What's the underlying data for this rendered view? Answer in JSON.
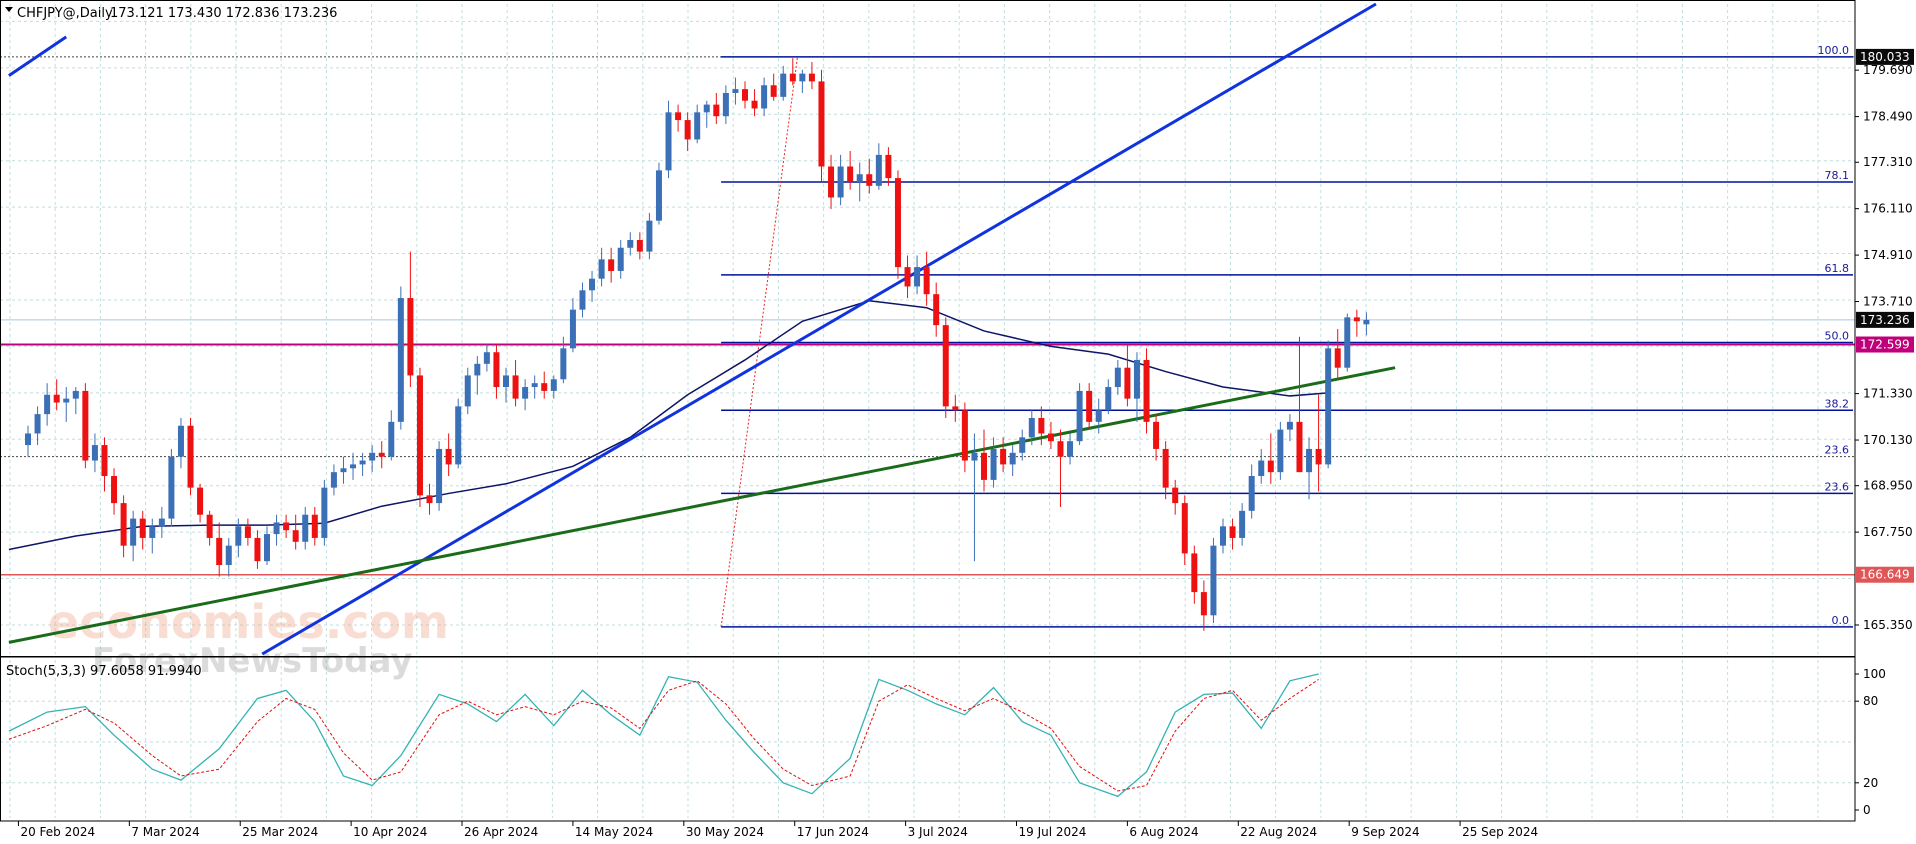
{
  "header": {
    "symbol_label": "CHFJPY@,Daily",
    "ohlc": "173.121 173.430 172.836 173.236",
    "stoch_label": "Stoch(5,3,3) 97.6058 91.9940"
  },
  "watermark": {
    "line1": "economies.com",
    "line2": "ForexNewsToday"
  },
  "colors": {
    "bull": "#3b6fb6",
    "bear": "#ee1111",
    "ma": "#0d1566",
    "trend_blue": "#1133dd",
    "trend_green": "#1a6b1a",
    "fib": "#00129b",
    "magenta": "#c0007a",
    "red_level": "#e05555",
    "stoch_main": "#33b3b3",
    "stoch_signal": "#e01010",
    "grid": "#c4dede"
  },
  "chart_data": {
    "type": "candlestick",
    "ylim": [
      164.6,
      181.4
    ],
    "x_tick_labels": [
      "20 Feb 2024",
      "7 Mar 2024",
      "25 Mar 2024",
      "10 Apr 2024",
      "26 Apr 2024",
      "14 May 2024",
      "30 May 2024",
      "17 Jun 2024",
      "3 Jul 2024",
      "19 Jul 2024",
      "6 Aug 2024",
      "22 Aug 2024",
      "9 Sep 2024",
      "25 Sep 2024"
    ],
    "y_tick_labels": [
      179.69,
      178.49,
      177.31,
      176.11,
      174.91,
      173.71,
      171.33,
      170.13,
      168.95,
      167.75,
      165.35
    ],
    "price_tags": [
      {
        "value": 180.033,
        "label": "180.033",
        "style": "dark"
      },
      {
        "value": 173.236,
        "label": "173.236",
        "style": "dark"
      },
      {
        "value": 172.599,
        "label": "172.599",
        "style": "magenta"
      },
      {
        "value": 166.649,
        "label": "166.649",
        "style": "red"
      }
    ],
    "horizontal_lines": [
      {
        "name": "magenta-resistance",
        "value": 172.599,
        "color": "magenta"
      },
      {
        "name": "red-support",
        "value": 166.649,
        "color": "red"
      },
      {
        "name": "current-price",
        "value": 173.236,
        "color": "light"
      },
      {
        "name": "dotted-top",
        "value": 180.033,
        "color": "dotted"
      },
      {
        "name": "dotted-236",
        "value": 169.7,
        "color": "dotted"
      }
    ],
    "fibonacci": {
      "levels": [
        {
          "label": "100.0",
          "value": 180.033
        },
        {
          "label": "78.1",
          "value": 176.8
        },
        {
          "label": "61.8",
          "value": 174.4
        },
        {
          "label": "50.0",
          "value": 172.65
        },
        {
          "label": "38.2",
          "value": 170.9
        },
        {
          "label": "23.6",
          "value": 168.75
        },
        {
          "label": "0.0",
          "value": 165.3
        }
      ],
      "extra_level": {
        "label": "23.6",
        "value": 169.7
      }
    },
    "trendlines": [
      {
        "name": "blue-trendline-upper",
        "color": "trend_blue",
        "x1": -2,
        "y1": 179.55,
        "x2": 4,
        "y2": 180.55
      },
      {
        "name": "blue-trendline-main",
        "color": "trend_blue",
        "x1": 24.5,
        "y1": 164.6,
        "x2": 141,
        "y2": 181.4
      },
      {
        "name": "green-trendline",
        "color": "trend_green",
        "x1": -2,
        "y1": 164.9,
        "x2": 143,
        "y2": 172.0
      }
    ],
    "fib_swing_line": {
      "x1": 72.5,
      "y1": 165.3,
      "x2": 80.5,
      "y2": 180.05
    },
    "candles": [
      [
        170.0,
        170.5,
        169.7,
        170.3
      ],
      [
        170.3,
        171.0,
        170.0,
        170.8
      ],
      [
        170.8,
        171.6,
        170.5,
        171.3
      ],
      [
        171.3,
        171.7,
        170.9,
        171.1
      ],
      [
        171.1,
        171.5,
        170.6,
        171.2
      ],
      [
        171.2,
        171.5,
        170.8,
        171.4
      ],
      [
        171.4,
        171.6,
        169.4,
        169.6
      ],
      [
        169.6,
        170.3,
        169.3,
        170.0
      ],
      [
        170.0,
        170.2,
        168.8,
        169.2
      ],
      [
        169.2,
        169.4,
        168.2,
        168.5
      ],
      [
        168.5,
        168.7,
        167.1,
        167.4
      ],
      [
        167.4,
        168.3,
        167.0,
        168.1
      ],
      [
        168.1,
        168.3,
        167.3,
        167.6
      ],
      [
        167.6,
        168.1,
        167.2,
        167.9
      ],
      [
        167.9,
        168.4,
        167.6,
        168.1
      ],
      [
        168.1,
        169.9,
        167.9,
        169.7
      ],
      [
        169.7,
        170.7,
        169.4,
        170.5
      ],
      [
        170.5,
        170.7,
        168.7,
        168.9
      ],
      [
        168.9,
        169.0,
        168.0,
        168.2
      ],
      [
        168.2,
        168.3,
        167.4,
        167.6
      ],
      [
        167.6,
        168.0,
        166.6,
        166.9
      ],
      [
        166.9,
        167.6,
        166.6,
        167.4
      ],
      [
        167.4,
        168.1,
        167.1,
        167.9
      ],
      [
        167.9,
        168.1,
        167.4,
        167.6
      ],
      [
        167.6,
        167.8,
        166.8,
        167.0
      ],
      [
        167.0,
        167.9,
        166.9,
        167.7
      ],
      [
        167.7,
        168.2,
        167.4,
        168.0
      ],
      [
        168.0,
        168.2,
        167.6,
        167.8
      ],
      [
        167.8,
        168.2,
        167.3,
        167.5
      ],
      [
        167.5,
        168.4,
        167.3,
        168.2
      ],
      [
        168.2,
        168.4,
        167.4,
        167.6
      ],
      [
        167.6,
        169.1,
        167.4,
        168.9
      ],
      [
        168.9,
        169.5,
        168.7,
        169.3
      ],
      [
        169.3,
        169.7,
        169.0,
        169.4
      ],
      [
        169.4,
        169.8,
        169.1,
        169.5
      ],
      [
        169.5,
        169.8,
        169.2,
        169.6
      ],
      [
        169.6,
        170.0,
        169.3,
        169.8
      ],
      [
        169.8,
        170.1,
        169.4,
        169.7
      ],
      [
        169.7,
        170.9,
        169.6,
        170.6
      ],
      [
        170.6,
        174.1,
        170.4,
        173.8
      ],
      [
        173.8,
        175.0,
        171.5,
        171.8
      ],
      [
        171.8,
        172.0,
        168.4,
        168.7
      ],
      [
        168.7,
        169.0,
        168.2,
        168.5
      ],
      [
        168.5,
        170.1,
        168.3,
        169.9
      ],
      [
        169.9,
        170.3,
        169.2,
        169.5
      ],
      [
        169.5,
        171.2,
        169.4,
        171.0
      ],
      [
        171.0,
        172.0,
        170.8,
        171.8
      ],
      [
        171.8,
        172.3,
        171.3,
        172.1
      ],
      [
        172.1,
        172.6,
        171.9,
        172.4
      ],
      [
        172.4,
        172.6,
        171.2,
        171.5
      ],
      [
        171.5,
        172.0,
        171.1,
        171.8
      ],
      [
        171.8,
        172.2,
        171.0,
        171.2
      ],
      [
        171.2,
        171.7,
        170.9,
        171.5
      ],
      [
        171.5,
        171.8,
        171.2,
        171.6
      ],
      [
        171.6,
        171.9,
        171.2,
        171.4
      ],
      [
        171.4,
        171.8,
        171.2,
        171.7
      ],
      [
        171.7,
        172.8,
        171.6,
        172.5
      ],
      [
        172.5,
        173.8,
        172.4,
        173.5
      ],
      [
        173.5,
        174.2,
        173.3,
        174.0
      ],
      [
        174.0,
        174.5,
        173.7,
        174.3
      ],
      [
        174.3,
        175.1,
        174.1,
        174.8
      ],
      [
        174.8,
        175.1,
        174.2,
        174.5
      ],
      [
        174.5,
        175.3,
        174.3,
        175.1
      ],
      [
        175.1,
        175.5,
        174.9,
        175.3
      ],
      [
        175.3,
        175.5,
        174.8,
        175.0
      ],
      [
        175.0,
        176.0,
        174.8,
        175.8
      ],
      [
        175.8,
        177.3,
        175.7,
        177.1
      ],
      [
        177.1,
        178.9,
        176.9,
        178.6
      ],
      [
        178.6,
        178.8,
        178.1,
        178.4
      ],
      [
        178.4,
        178.6,
        177.6,
        177.9
      ],
      [
        177.9,
        178.8,
        177.8,
        178.6
      ],
      [
        178.6,
        178.9,
        178.2,
        178.8
      ],
      [
        178.8,
        179.1,
        178.3,
        178.5
      ],
      [
        178.5,
        179.3,
        178.3,
        179.1
      ],
      [
        179.1,
        179.5,
        178.8,
        179.2
      ],
      [
        179.2,
        179.4,
        178.7,
        178.9
      ],
      [
        178.9,
        179.2,
        178.5,
        178.7
      ],
      [
        178.7,
        179.5,
        178.5,
        179.3
      ],
      [
        179.3,
        179.6,
        178.9,
        179.0
      ],
      [
        179.0,
        179.8,
        178.9,
        179.6
      ],
      [
        179.6,
        180.0,
        179.3,
        179.4
      ],
      [
        179.4,
        179.7,
        179.1,
        179.6
      ],
      [
        179.6,
        179.9,
        179.2,
        179.4
      ],
      [
        179.4,
        179.7,
        176.8,
        177.2
      ],
      [
        177.2,
        177.5,
        176.1,
        176.4
      ],
      [
        176.4,
        177.5,
        176.2,
        177.2
      ],
      [
        177.2,
        177.6,
        176.6,
        176.8
      ],
      [
        176.8,
        177.3,
        176.3,
        177.0
      ],
      [
        177.0,
        177.4,
        176.5,
        176.7
      ],
      [
        176.7,
        177.8,
        176.6,
        177.5
      ],
      [
        177.5,
        177.7,
        176.7,
        176.9
      ],
      [
        176.9,
        177.1,
        174.3,
        174.6
      ],
      [
        174.6,
        174.9,
        173.8,
        174.1
      ],
      [
        174.1,
        174.9,
        173.9,
        174.6
      ],
      [
        174.6,
        175.0,
        173.6,
        173.9
      ],
      [
        173.9,
        174.2,
        172.8,
        173.1
      ],
      [
        173.1,
        173.3,
        170.7,
        171.0
      ],
      [
        171.0,
        171.3,
        170.6,
        170.9
      ],
      [
        170.9,
        171.1,
        169.3,
        169.6
      ],
      [
        169.6,
        170.3,
        167.0,
        169.8
      ],
      [
        169.8,
        170.4,
        168.8,
        169.1
      ],
      [
        169.1,
        170.2,
        168.9,
        169.9
      ],
      [
        169.9,
        170.2,
        169.3,
        169.5
      ],
      [
        169.5,
        170.0,
        169.2,
        169.8
      ],
      [
        169.8,
        170.4,
        169.6,
        170.2
      ],
      [
        170.2,
        170.9,
        170.0,
        170.7
      ],
      [
        170.7,
        171.0,
        170.0,
        170.3
      ],
      [
        170.3,
        170.6,
        169.9,
        170.1
      ],
      [
        170.1,
        170.4,
        168.4,
        169.7
      ],
      [
        169.7,
        170.3,
        169.5,
        170.1
      ],
      [
        170.1,
        171.6,
        170.0,
        171.4
      ],
      [
        171.4,
        171.6,
        170.4,
        170.6
      ],
      [
        170.6,
        171.2,
        170.3,
        170.9
      ],
      [
        170.9,
        171.7,
        170.8,
        171.5
      ],
      [
        171.5,
        172.2,
        171.3,
        172.0
      ],
      [
        172.0,
        172.6,
        171.0,
        171.2
      ],
      [
        171.2,
        172.4,
        170.6,
        172.2
      ],
      [
        172.2,
        172.5,
        170.3,
        170.6
      ],
      [
        170.6,
        170.8,
        169.6,
        169.9
      ],
      [
        169.9,
        170.1,
        168.6,
        168.9
      ],
      [
        168.9,
        169.1,
        168.2,
        168.5
      ],
      [
        168.5,
        168.7,
        166.9,
        167.2
      ],
      [
        167.2,
        167.4,
        165.9,
        166.2
      ],
      [
        166.2,
        166.5,
        165.2,
        165.6
      ],
      [
        165.6,
        167.6,
        165.4,
        167.4
      ],
      [
        167.4,
        168.1,
        167.2,
        167.9
      ],
      [
        167.9,
        168.1,
        167.3,
        167.6
      ],
      [
        167.6,
        168.5,
        167.4,
        168.3
      ],
      [
        168.3,
        169.5,
        168.1,
        169.2
      ],
      [
        169.2,
        169.9,
        169.0,
        169.6
      ],
      [
        169.6,
        170.3,
        169.0,
        169.3
      ],
      [
        169.3,
        170.6,
        169.1,
        170.4
      ],
      [
        170.4,
        170.8,
        170.1,
        170.6
      ],
      [
        170.6,
        172.8,
        170.4,
        169.3
      ],
      [
        169.3,
        170.2,
        168.6,
        169.9
      ],
      [
        169.9,
        171.3,
        168.8,
        169.5
      ],
      [
        169.5,
        172.7,
        169.4,
        172.5
      ],
      [
        172.5,
        173.0,
        171.7,
        172.0
      ],
      [
        172.0,
        173.4,
        171.9,
        173.3
      ],
      [
        173.3,
        173.5,
        172.8,
        173.2
      ],
      [
        173.121,
        173.43,
        172.836,
        173.236
      ]
    ],
    "ma_points": [
      [
        -2,
        167.3
      ],
      [
        5,
        167.65
      ],
      [
        12,
        167.9
      ],
      [
        19,
        167.93
      ],
      [
        25,
        167.93
      ],
      [
        31,
        167.98
      ],
      [
        37,
        168.42
      ],
      [
        44,
        168.75
      ],
      [
        50,
        169.0
      ],
      [
        57,
        169.45
      ],
      [
        63,
        170.2
      ],
      [
        69,
        171.3
      ],
      [
        75,
        172.2
      ],
      [
        81,
        173.2
      ],
      [
        88,
        173.73
      ],
      [
        94,
        173.55
      ],
      [
        100,
        172.95
      ],
      [
        107,
        172.55
      ],
      [
        113,
        172.35
      ],
      [
        119,
        171.9
      ],
      [
        125,
        171.5
      ],
      [
        132,
        171.27
      ],
      [
        136,
        171.35
      ]
    ],
    "stochastic": {
      "ylim": [
        0,
        100
      ],
      "levels": [
        20,
        80
      ],
      "tick_labels": [
        0,
        20,
        80,
        100
      ],
      "main": [
        [
          -2,
          58
        ],
        [
          2,
          72
        ],
        [
          6,
          76
        ],
        [
          9,
          55
        ],
        [
          13,
          30
        ],
        [
          16,
          22
        ],
        [
          20,
          45
        ],
        [
          24,
          82
        ],
        [
          27,
          88
        ],
        [
          30,
          65
        ],
        [
          33,
          25
        ],
        [
          36,
          18
        ],
        [
          39,
          40
        ],
        [
          43,
          85
        ],
        [
          46,
          78
        ],
        [
          49,
          65
        ],
        [
          52,
          85
        ],
        [
          55,
          62
        ],
        [
          58,
          88
        ],
        [
          61,
          70
        ],
        [
          64,
          55
        ],
        [
          67,
          98
        ],
        [
          70,
          94
        ],
        [
          73,
          66
        ],
        [
          76,
          42
        ],
        [
          79,
          20
        ],
        [
          82,
          12
        ],
        [
          86,
          38
        ],
        [
          89,
          96
        ],
        [
          92,
          88
        ],
        [
          95,
          78
        ],
        [
          98,
          70
        ],
        [
          101,
          90
        ],
        [
          104,
          65
        ],
        [
          107,
          55
        ],
        [
          110,
          20
        ],
        [
          114,
          10
        ],
        [
          117,
          28
        ],
        [
          120,
          72
        ],
        [
          123,
          85
        ],
        [
          126,
          86
        ],
        [
          129,
          60
        ],
        [
          132,
          95
        ],
        [
          135,
          100
        ]
      ],
      "signal": [
        [
          -2,
          52
        ],
        [
          2,
          62
        ],
        [
          6,
          74
        ],
        [
          9,
          64
        ],
        [
          13,
          40
        ],
        [
          16,
          25
        ],
        [
          20,
          30
        ],
        [
          24,
          65
        ],
        [
          27,
          82
        ],
        [
          30,
          74
        ],
        [
          33,
          42
        ],
        [
          36,
          22
        ],
        [
          39,
          28
        ],
        [
          43,
          70
        ],
        [
          46,
          80
        ],
        [
          49,
          70
        ],
        [
          52,
          76
        ],
        [
          55,
          70
        ],
        [
          58,
          80
        ],
        [
          61,
          75
        ],
        [
          64,
          60
        ],
        [
          67,
          88
        ],
        [
          70,
          95
        ],
        [
          73,
          78
        ],
        [
          76,
          52
        ],
        [
          79,
          30
        ],
        [
          82,
          18
        ],
        [
          86,
          25
        ],
        [
          89,
          80
        ],
        [
          92,
          92
        ],
        [
          95,
          82
        ],
        [
          98,
          73
        ],
        [
          101,
          82
        ],
        [
          104,
          72
        ],
        [
          107,
          60
        ],
        [
          110,
          32
        ],
        [
          114,
          14
        ],
        [
          117,
          18
        ],
        [
          120,
          58
        ],
        [
          123,
          82
        ],
        [
          126,
          88
        ],
        [
          129,
          66
        ],
        [
          132,
          82
        ],
        [
          135,
          96
        ]
      ]
    }
  }
}
